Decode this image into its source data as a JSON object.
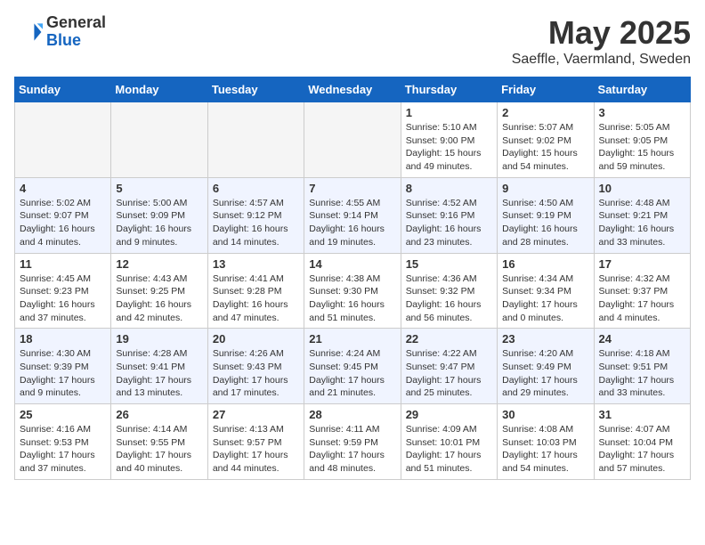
{
  "logo": {
    "general": "General",
    "blue": "Blue"
  },
  "title": "May 2025",
  "subtitle": "Saeffle, Vaermland, Sweden",
  "days_of_week": [
    "Sunday",
    "Monday",
    "Tuesday",
    "Wednesday",
    "Thursday",
    "Friday",
    "Saturday"
  ],
  "weeks": [
    [
      {
        "day": "",
        "info": ""
      },
      {
        "day": "",
        "info": ""
      },
      {
        "day": "",
        "info": ""
      },
      {
        "day": "",
        "info": ""
      },
      {
        "day": "1",
        "info": "Sunrise: 5:10 AM\nSunset: 9:00 PM\nDaylight: 15 hours\nand 49 minutes."
      },
      {
        "day": "2",
        "info": "Sunrise: 5:07 AM\nSunset: 9:02 PM\nDaylight: 15 hours\nand 54 minutes."
      },
      {
        "day": "3",
        "info": "Sunrise: 5:05 AM\nSunset: 9:05 PM\nDaylight: 15 hours\nand 59 minutes."
      }
    ],
    [
      {
        "day": "4",
        "info": "Sunrise: 5:02 AM\nSunset: 9:07 PM\nDaylight: 16 hours\nand 4 minutes."
      },
      {
        "day": "5",
        "info": "Sunrise: 5:00 AM\nSunset: 9:09 PM\nDaylight: 16 hours\nand 9 minutes."
      },
      {
        "day": "6",
        "info": "Sunrise: 4:57 AM\nSunset: 9:12 PM\nDaylight: 16 hours\nand 14 minutes."
      },
      {
        "day": "7",
        "info": "Sunrise: 4:55 AM\nSunset: 9:14 PM\nDaylight: 16 hours\nand 19 minutes."
      },
      {
        "day": "8",
        "info": "Sunrise: 4:52 AM\nSunset: 9:16 PM\nDaylight: 16 hours\nand 23 minutes."
      },
      {
        "day": "9",
        "info": "Sunrise: 4:50 AM\nSunset: 9:19 PM\nDaylight: 16 hours\nand 28 minutes."
      },
      {
        "day": "10",
        "info": "Sunrise: 4:48 AM\nSunset: 9:21 PM\nDaylight: 16 hours\nand 33 minutes."
      }
    ],
    [
      {
        "day": "11",
        "info": "Sunrise: 4:45 AM\nSunset: 9:23 PM\nDaylight: 16 hours\nand 37 minutes."
      },
      {
        "day": "12",
        "info": "Sunrise: 4:43 AM\nSunset: 9:25 PM\nDaylight: 16 hours\nand 42 minutes."
      },
      {
        "day": "13",
        "info": "Sunrise: 4:41 AM\nSunset: 9:28 PM\nDaylight: 16 hours\nand 47 minutes."
      },
      {
        "day": "14",
        "info": "Sunrise: 4:38 AM\nSunset: 9:30 PM\nDaylight: 16 hours\nand 51 minutes."
      },
      {
        "day": "15",
        "info": "Sunrise: 4:36 AM\nSunset: 9:32 PM\nDaylight: 16 hours\nand 56 minutes."
      },
      {
        "day": "16",
        "info": "Sunrise: 4:34 AM\nSunset: 9:34 PM\nDaylight: 17 hours\nand 0 minutes."
      },
      {
        "day": "17",
        "info": "Sunrise: 4:32 AM\nSunset: 9:37 PM\nDaylight: 17 hours\nand 4 minutes."
      }
    ],
    [
      {
        "day": "18",
        "info": "Sunrise: 4:30 AM\nSunset: 9:39 PM\nDaylight: 17 hours\nand 9 minutes."
      },
      {
        "day": "19",
        "info": "Sunrise: 4:28 AM\nSunset: 9:41 PM\nDaylight: 17 hours\nand 13 minutes."
      },
      {
        "day": "20",
        "info": "Sunrise: 4:26 AM\nSunset: 9:43 PM\nDaylight: 17 hours\nand 17 minutes."
      },
      {
        "day": "21",
        "info": "Sunrise: 4:24 AM\nSunset: 9:45 PM\nDaylight: 17 hours\nand 21 minutes."
      },
      {
        "day": "22",
        "info": "Sunrise: 4:22 AM\nSunset: 9:47 PM\nDaylight: 17 hours\nand 25 minutes."
      },
      {
        "day": "23",
        "info": "Sunrise: 4:20 AM\nSunset: 9:49 PM\nDaylight: 17 hours\nand 29 minutes."
      },
      {
        "day": "24",
        "info": "Sunrise: 4:18 AM\nSunset: 9:51 PM\nDaylight: 17 hours\nand 33 minutes."
      }
    ],
    [
      {
        "day": "25",
        "info": "Sunrise: 4:16 AM\nSunset: 9:53 PM\nDaylight: 17 hours\nand 37 minutes."
      },
      {
        "day": "26",
        "info": "Sunrise: 4:14 AM\nSunset: 9:55 PM\nDaylight: 17 hours\nand 40 minutes."
      },
      {
        "day": "27",
        "info": "Sunrise: 4:13 AM\nSunset: 9:57 PM\nDaylight: 17 hours\nand 44 minutes."
      },
      {
        "day": "28",
        "info": "Sunrise: 4:11 AM\nSunset: 9:59 PM\nDaylight: 17 hours\nand 48 minutes."
      },
      {
        "day": "29",
        "info": "Sunrise: 4:09 AM\nSunset: 10:01 PM\nDaylight: 17 hours\nand 51 minutes."
      },
      {
        "day": "30",
        "info": "Sunrise: 4:08 AM\nSunset: 10:03 PM\nDaylight: 17 hours\nand 54 minutes."
      },
      {
        "day": "31",
        "info": "Sunrise: 4:07 AM\nSunset: 10:04 PM\nDaylight: 17 hours\nand 57 minutes."
      }
    ]
  ]
}
